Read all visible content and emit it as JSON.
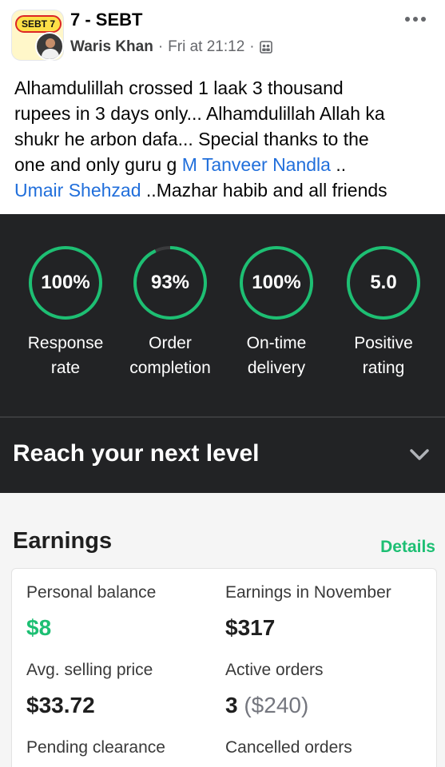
{
  "post": {
    "group_badge": "SEBT 7",
    "group_name": "7 - SEBT",
    "author": "Waris Khan",
    "separator": "·",
    "time": "Fri at 21:12",
    "text_line1": "Alhamdulillah crossed 1 laak 3 thousand",
    "text_line2": "rupees in 3 days only... Alhamdulillah Allah ka",
    "text_line3": "shukr he arbon dafa... Special thanks to the",
    "text_line4_pre": "one and only guru g ",
    "mention1": "M Tanveer Nandla",
    "text_line4_post": " ..",
    "mention2": "Umair Shehzad",
    "text_line5_post": " ..Mazhar habib and all friends"
  },
  "stats": [
    {
      "value": "100%",
      "label1": "Response",
      "label2": "rate",
      "progress": 1.0
    },
    {
      "value": "93%",
      "label1": "Order",
      "label2": "completion",
      "progress": 0.93
    },
    {
      "value": "100%",
      "label1": "On-time",
      "label2": "delivery",
      "progress": 1.0
    },
    {
      "value": "5.0",
      "label1": "Positive",
      "label2": "rating",
      "progress": 1.0
    }
  ],
  "level": {
    "title": "Reach your next level"
  },
  "earnings": {
    "heading": "Earnings",
    "details_link": "Details",
    "personal_balance_label": "Personal balance",
    "personal_balance_value": "$8",
    "earnings_month_label": "Earnings in November",
    "earnings_month_value": "$317",
    "avg_price_label": "Avg. selling price",
    "avg_price_value": "$33.72",
    "active_orders_label": "Active orders",
    "active_orders_count": "3",
    "active_orders_amount": "($240)",
    "pending_label": "Pending clearance",
    "cancelled_label": "Cancelled orders"
  },
  "colors": {
    "accent_green": "#1dbf73",
    "ring_track": "#3a3b3d",
    "mention_blue": "#216fdb",
    "dark_panel": "#222325"
  },
  "icons": {
    "more": "more-horizontal-icon",
    "privacy": "group-privacy-icon",
    "chevron": "chevron-down-icon"
  }
}
